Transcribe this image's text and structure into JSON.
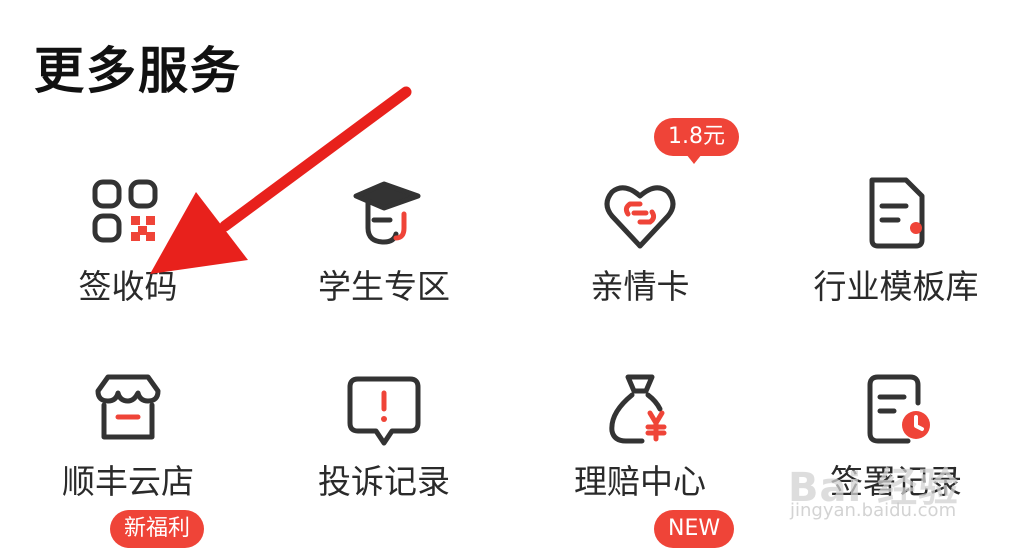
{
  "section": {
    "title": "更多服务"
  },
  "services": [
    {
      "label": "签收码",
      "icon": "qr-code-icon"
    },
    {
      "label": "学生专区",
      "icon": "graduation-cap-icon"
    },
    {
      "label": "亲情卡",
      "icon": "heart-link-icon",
      "badge": "1.8元"
    },
    {
      "label": "行业模板库",
      "icon": "document-template-icon"
    },
    {
      "label": "顺丰云店",
      "icon": "store-icon",
      "badge": "新福利"
    },
    {
      "label": "投诉记录",
      "icon": "complaint-icon"
    },
    {
      "label": "理赔中心",
      "icon": "money-bag-icon",
      "badge": "NEW"
    },
    {
      "label": "签署记录",
      "icon": "sign-record-icon"
    }
  ],
  "watermark": {
    "text": "Bai 经验",
    "sub": "jingyan.baidu.com"
  },
  "colors": {
    "accent": "#ef4438",
    "icon_stroke": "#333333",
    "arrow": "#e8211c"
  }
}
